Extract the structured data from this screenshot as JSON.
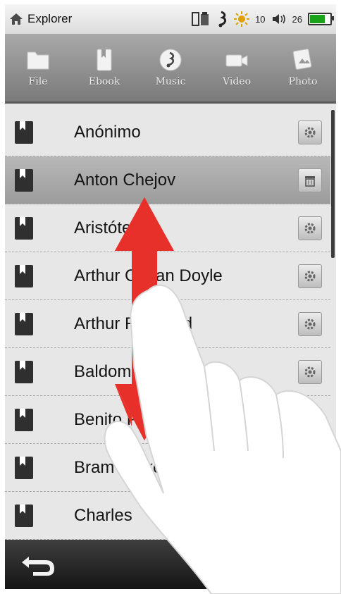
{
  "status_bar": {
    "title": "Explorer",
    "brightness": "10",
    "volume": "26",
    "battery_level": 0.8,
    "icons": [
      "home-icon",
      "usb-storage-icon",
      "music-note-icon",
      "brightness-icon",
      "volume-icon",
      "battery-icon"
    ]
  },
  "tabs": [
    {
      "label": "File",
      "icon": "folder-icon"
    },
    {
      "label": "Ebook",
      "icon": "ebook-icon"
    },
    {
      "label": "Music",
      "icon": "music-note-icon"
    },
    {
      "label": "Video",
      "icon": "video-camera-icon"
    },
    {
      "label": "Photo",
      "icon": "photo-icon"
    }
  ],
  "list": {
    "items": [
      {
        "label": "Anónimo",
        "action": "settings-icon"
      },
      {
        "label": "Anton Chejov",
        "action": "delete-icon",
        "selected": true
      },
      {
        "label": "Aristóteles",
        "action": "settings-icon"
      },
      {
        "label": "Arthur Conan Doyle",
        "action": "settings-icon"
      },
      {
        "label": "Arthur Rimbaud",
        "action": "settings-icon"
      },
      {
        "label": "Baldomero Lillo",
        "action": "settings-icon"
      },
      {
        "label": "Benito Pérez",
        "action": "settings-icon"
      },
      {
        "label": "Bram Stoker",
        "action": ""
      },
      {
        "label": "Charles",
        "action": ""
      }
    ]
  },
  "bottom_bar": {
    "back_icon": "back-arrow-icon"
  },
  "overlay": {
    "gesture": "swipe-up-down-arrow-icon",
    "hand": "pointing-hand-icon",
    "accent": "#e8302a"
  }
}
